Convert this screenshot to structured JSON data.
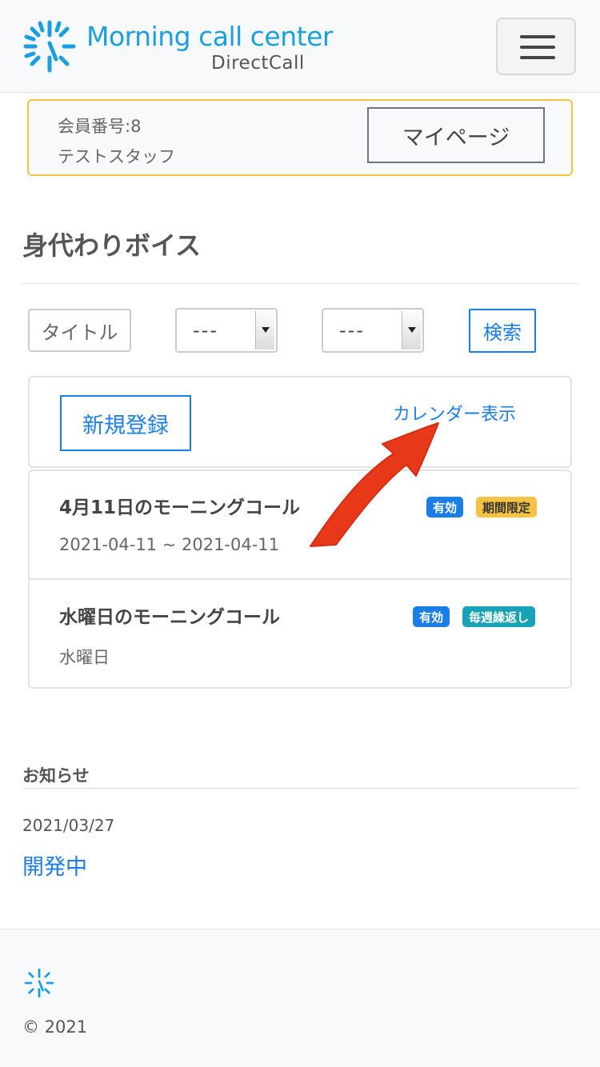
{
  "header": {
    "logo_title": "Morning call center",
    "logo_subtitle": "DirectCall",
    "menu_icon": "hamburger-icon"
  },
  "member": {
    "number": "会員番号:8",
    "name": "テストスタッフ",
    "mypage_label": "マイページ"
  },
  "page": {
    "title": "身代わりボイス"
  },
  "filters": {
    "title_label": "タイトル",
    "select_1_value": "---",
    "select_2_value": "---",
    "search_label": "検索"
  },
  "actions": {
    "new_label": "新規登録",
    "calendar_label": "カレンダー表示"
  },
  "list": {
    "items": [
      {
        "title": "4月11日のモーニングコール",
        "sub": "2021-04-11 ~ 2021-04-11",
        "badges": [
          "有効",
          "期間限定"
        ]
      },
      {
        "title": "水曜日のモーニングコール",
        "sub": "水曜日",
        "badges": [
          "有効",
          "毎週繰返し"
        ]
      }
    ]
  },
  "notice": {
    "title": "お知らせ",
    "date": "2021/03/27",
    "link": "開発中"
  },
  "footer": {
    "copyright": "© 2021"
  },
  "colors": {
    "brand": "#1a9fe0",
    "link": "#1a7ee8",
    "warning": "#f5c242",
    "info": "#17a2b8",
    "annotation": "#e8381a"
  }
}
